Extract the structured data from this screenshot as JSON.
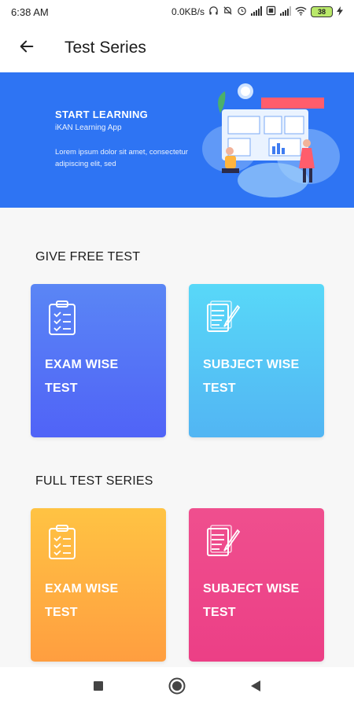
{
  "status_bar": {
    "time": "6:38 AM",
    "network_speed": "0.0KB/s",
    "battery_level": "38"
  },
  "app_bar": {
    "title": "Test Series",
    "back_icon": "arrow-left-icon"
  },
  "banner": {
    "title": "START LEARNING",
    "subtitle": "iKAN Learning App",
    "description": "Lorem ipsum dolor sit amet, consectetur adipiscing elit, sed"
  },
  "sections": [
    {
      "title": "GIVE FREE TEST",
      "cards": [
        {
          "line1": "EXAM WISE",
          "line2": "TEST",
          "icon": "clipboard-checklist-icon"
        },
        {
          "line1": "SUBJECT WISE",
          "line2": "TEST",
          "icon": "document-pen-icon"
        }
      ]
    },
    {
      "title": "FULL TEST SERIES",
      "cards": [
        {
          "line1": "EXAM WISE",
          "line2": "TEST",
          "icon": "clipboard-checklist-icon"
        },
        {
          "line1": "SUBJECT WISE",
          "line2": "TEST",
          "icon": "document-pen-icon"
        }
      ]
    }
  ],
  "colors": {
    "banner": "#2e74f3",
    "card_blue_top": "#5a86f5",
    "card_blue_bottom": "#5063f7",
    "card_cyan_top": "#58d8f8",
    "card_cyan_bottom": "#52b5f3",
    "card_orange_top": "#ffc343",
    "card_orange_bottom": "#ff9e40",
    "card_pink_top": "#ef4f8e",
    "card_pink_bottom": "#ec3f86"
  },
  "nav_bar": {
    "recents_icon": "square-recents-icon",
    "home_icon": "circle-home-icon",
    "back_icon": "triangle-back-icon"
  }
}
